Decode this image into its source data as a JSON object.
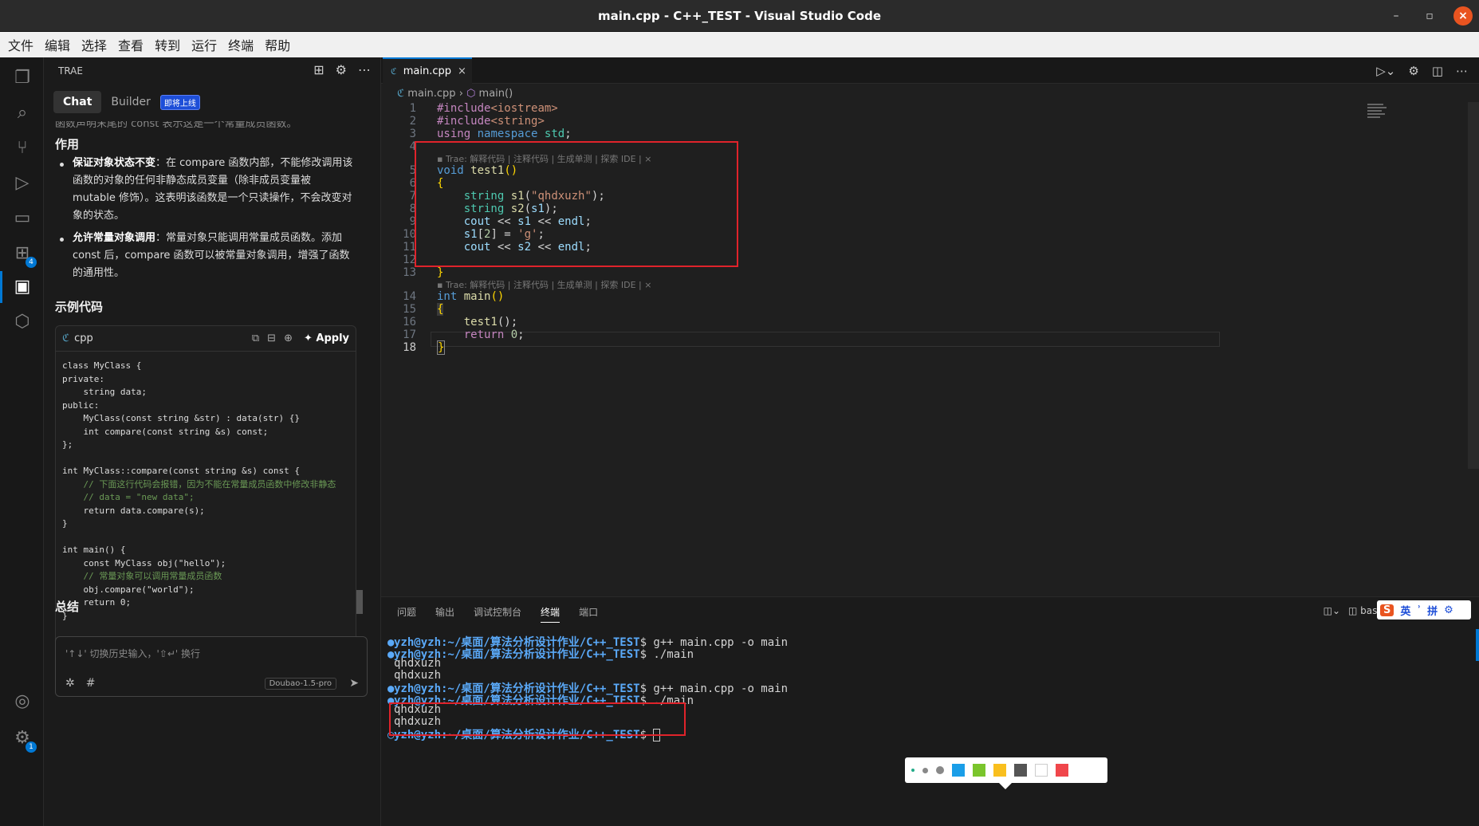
{
  "window": {
    "title": "main.cpp - C++_TEST - Visual Studio Code"
  },
  "menu": [
    "文件",
    "编辑",
    "选择",
    "查看",
    "转到",
    "运行",
    "终端",
    "帮助"
  ],
  "activity": {
    "ext_badge": "4",
    "settings_badge": "1"
  },
  "sidebar": {
    "header": "TRAE",
    "tab_chat": "Chat",
    "tab_builder": "Builder",
    "builder_badge": "即将上线",
    "top_cut": "函数声明末尾的 const 表示这是一个常量成员函数。",
    "section_role": "作用",
    "bullet1_title": "保证对象状态不变",
    "bullet1_text": "：在 compare 函数内部，不能修改调用该函数的对象的任何非静态成员变量（除非成员变量被 mutable 修饰）。这表明该函数是一个只读操作，不会改变对象的状态。",
    "bullet2_title": "允许常量对象调用",
    "bullet2_text": "：常量对象只能调用常量成员函数。添加 const 后，compare 函数可以被常量对象调用，增强了函数的通用性。",
    "section_example": "示例代码",
    "code_lang": "cpp",
    "apply_label": "Apply",
    "code_lines": [
      "class MyClass {",
      "private:",
      "    string data;",
      "public:",
      "    MyClass(const string &str) : data(str) {}",
      "    int compare(const string &s) const;",
      "};",
      "",
      "int MyClass::compare(const string &s) const {",
      "    // 下面这行代码会报错，因为不能在常量成员函数中修改非静态",
      "    // data = \"new data\";",
      "    return data.compare(s);",
      "}",
      "",
      "int main() {",
      "    const MyClass obj(\"hello\");",
      "    // 常量对象可以调用常量成员函数",
      "    obj.compare(\"world\");",
      "    return 0;",
      "}"
    ],
    "section_summary": "总结",
    "input_placeholder": "'↑↓' 切换历史输入，'⇧↵' 换行",
    "model_name": "Doubao-1.5-pro"
  },
  "editor": {
    "tab_name": "main.cpp",
    "breadcrumb_file": "main.cpp",
    "breadcrumb_symbol": "main()",
    "codelens": "Trae: 解释代码 | 注释代码 | 生成单测 | 探索 IDE | ×",
    "line_numbers": [
      "1",
      "2",
      "3",
      "4",
      "5",
      "6",
      "7",
      "8",
      "9",
      "10",
      "11",
      "12",
      "13",
      "14",
      "15",
      "16",
      "17",
      "18"
    ]
  },
  "panel": {
    "tabs": [
      "问题",
      "输出",
      "调试控制台",
      "终端",
      "端口"
    ],
    "active_tab": "终端",
    "shell": "bash",
    "ime": {
      "logo": "S",
      "lang": "英",
      "mode": "拼"
    },
    "prompt": "yzh@yzh:~/桌面/算法分析设计作业/C++_TEST",
    "lines": [
      {
        "prompt": true,
        "cmd": "$ g++ main.cpp -o main"
      },
      {
        "prompt": true,
        "cmd": "$ ./main"
      },
      {
        "prompt": false,
        "cmd": "qhdxuzh"
      },
      {
        "prompt": false,
        "cmd": "qhdxuzh"
      },
      {
        "prompt": true,
        "cmd": "$ g++ main.cpp -o main"
      },
      {
        "prompt": true,
        "cmd": "$ ./main"
      },
      {
        "prompt": false,
        "cmd": "qhdxuzh"
      },
      {
        "prompt": false,
        "cmd": "qhdxuzh"
      },
      {
        "prompt": true,
        "cmd": "$ "
      }
    ]
  },
  "colors": {
    "accent": "#0078d4",
    "highlight_box": "#e0232b",
    "prompt": "#5aa9f8"
  },
  "palette_colors": [
    "#1a9ee8",
    "#7ac52c",
    "#f9bf1e",
    "#555555",
    "#ffffff",
    "#f0464b"
  ]
}
